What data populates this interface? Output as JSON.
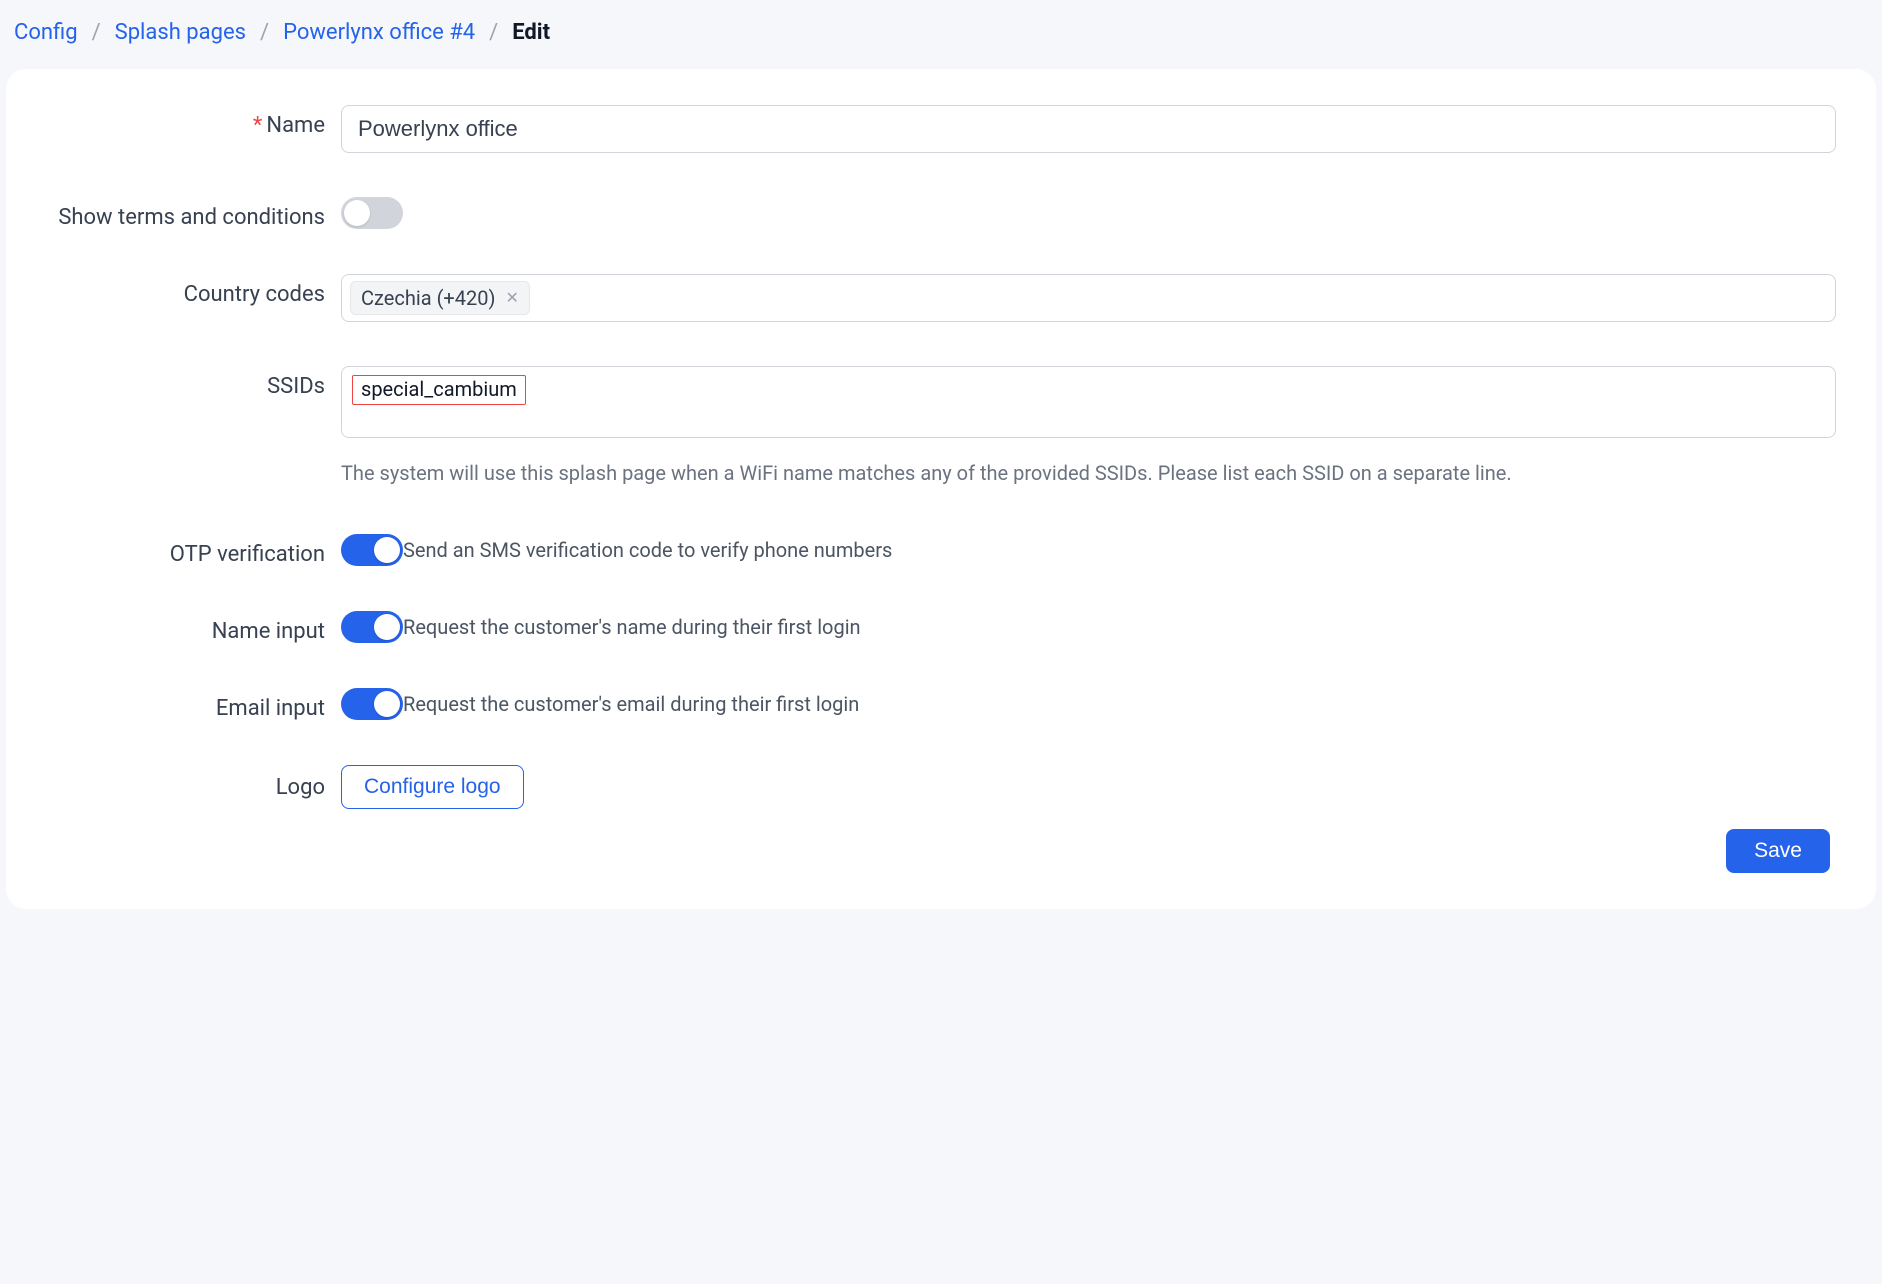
{
  "breadcrumb": {
    "config": "Config",
    "splash_pages": "Splash pages",
    "item": "Powerlynx office #4",
    "current": "Edit"
  },
  "form": {
    "name": {
      "label": "Name",
      "value": "Powerlynx office"
    },
    "show_terms": {
      "label": "Show terms and conditions",
      "value": false
    },
    "country_codes": {
      "label": "Country codes",
      "tags": [
        "Czechia (+420)"
      ]
    },
    "ssids": {
      "label": "SSIDs",
      "value": "special_cambium",
      "help": "The system will use this splash page when a WiFi name matches any of the provided SSIDs. Please list each SSID on a separate line."
    },
    "otp": {
      "label": "OTP verification",
      "value": true,
      "desc": "Send an SMS verification code to verify phone numbers"
    },
    "name_input": {
      "label": "Name input",
      "value": true,
      "desc": "Request the customer's name during their first login"
    },
    "email_input": {
      "label": "Email input",
      "value": true,
      "desc": "Request the customer's email during their first login"
    },
    "logo": {
      "label": "Logo",
      "button": "Configure logo"
    }
  },
  "actions": {
    "save": "Save"
  }
}
